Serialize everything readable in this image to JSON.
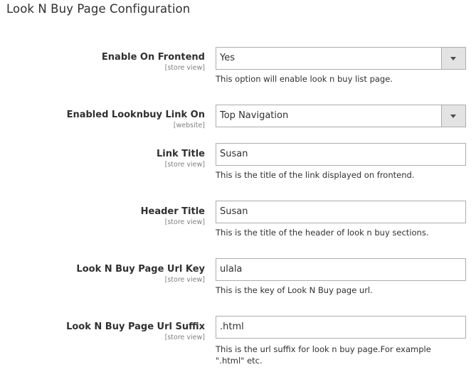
{
  "section": {
    "title": "Look N Buy Page Configuration"
  },
  "fields": [
    {
      "label": "Enable On Frontend",
      "scope": "[store view]",
      "type": "select",
      "value": "Yes",
      "note": "This option will enable look n buy list page."
    },
    {
      "label": "Enabled Looknbuy Link On",
      "scope": "[website]",
      "type": "select",
      "value": "Top Navigation",
      "note": ""
    },
    {
      "label": "Link Title",
      "scope": "[store view]",
      "type": "text",
      "value": "Susan",
      "note": "This is the title of the link displayed on frontend."
    },
    {
      "label": "Header Title",
      "scope": "[store view]",
      "type": "text",
      "value": "Susan",
      "note": "This is the title of the header of look n buy sections."
    },
    {
      "label": "Look N Buy Page Url Key",
      "scope": "[store view]",
      "type": "text",
      "value": "ulala",
      "note": "This is the key of Look N Buy page url."
    },
    {
      "label": "Look N Buy Page Url Suffix",
      "scope": "[store view]",
      "type": "text",
      "value": ".html",
      "note": "This is the url suffix for look n buy page.For example \".html\" etc."
    }
  ],
  "icons": {
    "select_arrow": "triangle-down-icon"
  }
}
